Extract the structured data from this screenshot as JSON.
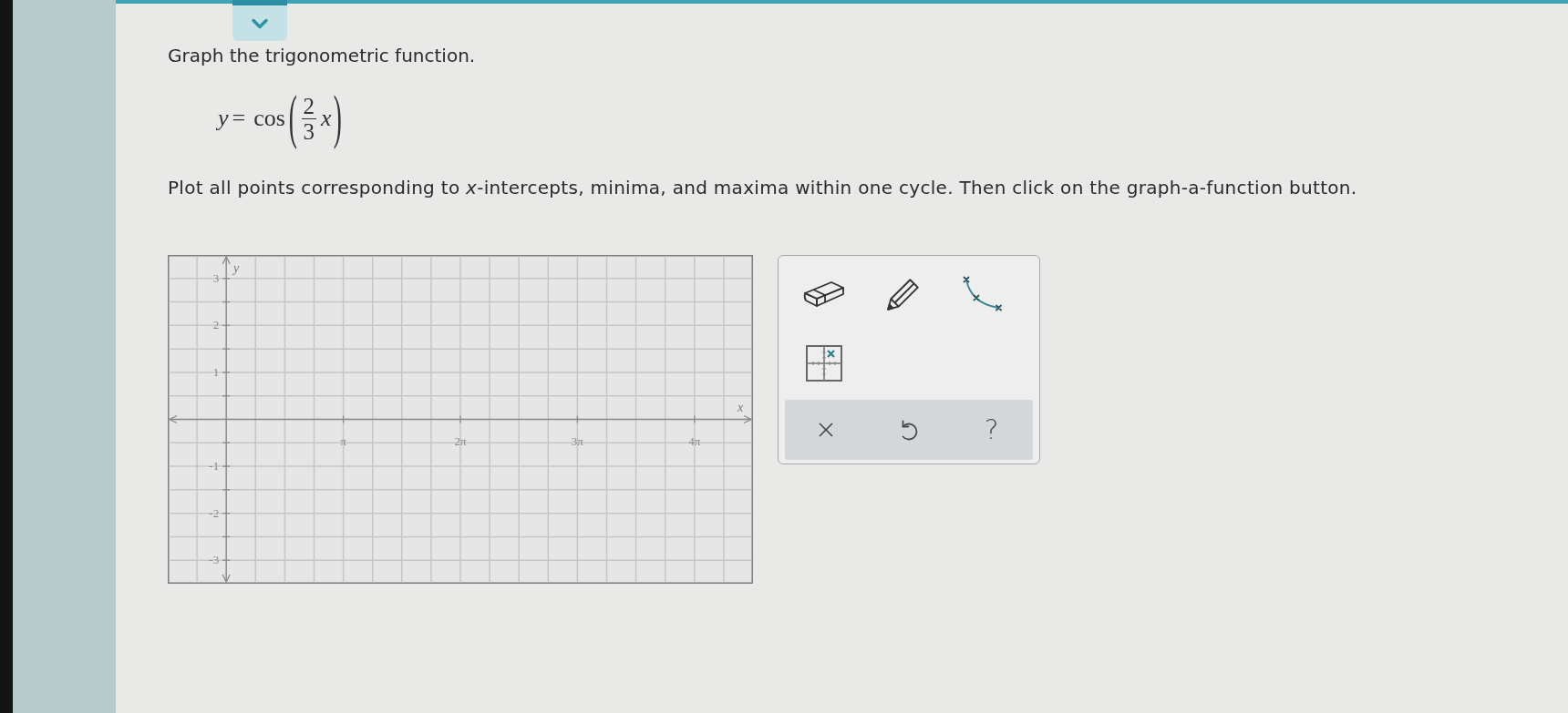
{
  "question": {
    "prompt": "Graph the trigonometric function.",
    "equation": {
      "lhs": "y",
      "relation": "=",
      "function": "cos",
      "open": "(",
      "numerator": "2",
      "denominator": "3",
      "argument": "x",
      "close": ")"
    },
    "instruction": "Plot all points corresponding to *x*-intercepts, minima, and maxima within one cycle. Then click on the graph-a-function button."
  },
  "graph": {
    "chart_data": {
      "type": "line",
      "grid": true,
      "xlabel": "x",
      "ylabel": "y",
      "xlim": [
        -1.5708,
        14.1372
      ],
      "ylim": [
        -3.5,
        3.5
      ],
      "xticks": [
        {
          "value": 3.1416,
          "label": "π"
        },
        {
          "value": 6.2832,
          "label": "2π"
        },
        {
          "value": 9.4248,
          "label": "3π"
        },
        {
          "value": 12.5664,
          "label": "4π"
        }
      ],
      "yticks": [
        -3,
        -2,
        -1,
        1,
        2,
        3
      ]
    }
  },
  "toolbar": {
    "tools": [
      {
        "kind": "eraser"
      },
      {
        "kind": "pencil"
      },
      {
        "kind": "function_curve"
      },
      {
        "kind": "point_grid"
      }
    ],
    "actions": [
      {
        "kind": "clear"
      },
      {
        "kind": "undo"
      },
      {
        "kind": "help",
        "label": "?"
      }
    ]
  }
}
